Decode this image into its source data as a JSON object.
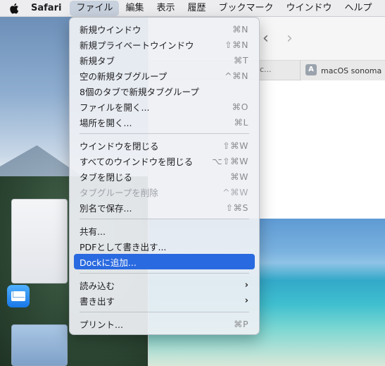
{
  "menubar": {
    "apple_icon": "apple-logo-icon",
    "app_name": "Safari",
    "items": [
      "ファイル",
      "編集",
      "表示",
      "履歴",
      "ブックマーク",
      "ウインドウ",
      "ヘルプ"
    ]
  },
  "safari": {
    "back_icon": "‹",
    "forward_icon": "›",
    "tab_left_title": "c...",
    "tab_right_favicon": "A",
    "tab_right_title": "macOS sonoma ウ"
  },
  "file_menu": {
    "groups": [
      [
        {
          "label": "新規ウインドウ",
          "shortcut": "⌘N"
        },
        {
          "label": "新規プライベートウインドウ",
          "shortcut": "⇧⌘N"
        },
        {
          "label": "新規タブ",
          "shortcut": "⌘T"
        },
        {
          "label": "空の新規タブグループ",
          "shortcut": "^⌘N"
        },
        {
          "label": "8個のタブで新規タブグループ",
          "shortcut": ""
        },
        {
          "label": "ファイルを開く...",
          "shortcut": "⌘O"
        },
        {
          "label": "場所を開く...",
          "shortcut": "⌘L"
        }
      ],
      [
        {
          "label": "ウインドウを閉じる",
          "shortcut": "⇧⌘W"
        },
        {
          "label": "すべてのウインドウを閉じる",
          "shortcut": "⌥⇧⌘W"
        },
        {
          "label": "タブを閉じる",
          "shortcut": "⌘W"
        },
        {
          "label": "タブグループを削除",
          "shortcut": "^⌘W",
          "disabled": true
        },
        {
          "label": "別名で保存...",
          "shortcut": "⇧⌘S"
        }
      ],
      [
        {
          "label": "共有...",
          "shortcut": ""
        },
        {
          "label": "PDFとして書き出す...",
          "shortcut": ""
        },
        {
          "label": "Dockに追加...",
          "shortcut": "",
          "highlighted": true
        }
      ],
      [
        {
          "label": "読み込む",
          "shortcut": "",
          "submenu": true
        },
        {
          "label": "書き出す",
          "shortcut": "",
          "submenu": true
        }
      ],
      [
        {
          "label": "プリント...",
          "shortcut": "⌘P"
        }
      ]
    ],
    "submenu_arrow": "›"
  },
  "colors": {
    "highlight": "#2a6ae0",
    "menu_bg": "#eef0f4"
  }
}
